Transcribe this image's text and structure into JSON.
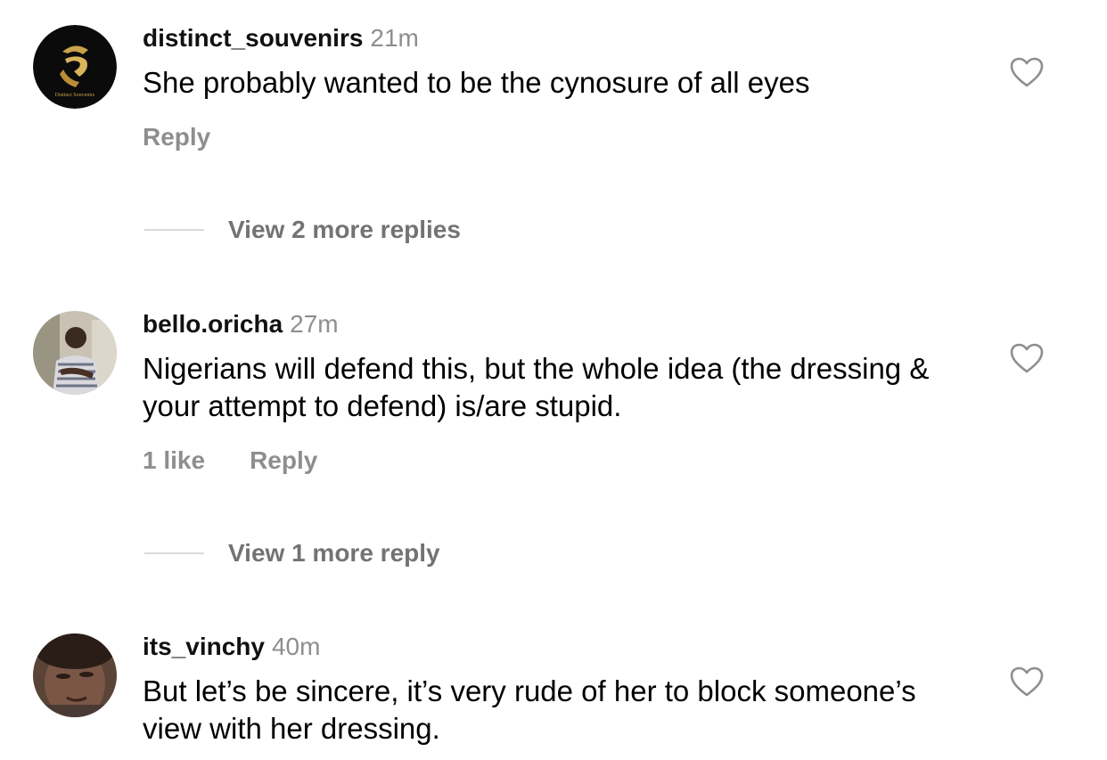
{
  "comments": [
    {
      "username": "distinct_souvenirs",
      "time": "21m",
      "text": "She probably wanted to be the cynosure of all eyes",
      "likes": "",
      "reply_label": "Reply",
      "avatar_icon": "distinct-souvenirs-logo",
      "avatar_text": "Distinct Souvenirs",
      "view_replies": "View 2 more replies"
    },
    {
      "username": "bello.oricha",
      "time": "27m",
      "text": "Nigerians will defend this, but the whole idea (the dressing & your attempt to defend) is/are stupid.",
      "likes": "1 like",
      "reply_label": "Reply",
      "avatar_icon": "user-photo",
      "view_replies": "View 1 more reply"
    },
    {
      "username": "its_vinchy",
      "time": "40m",
      "text": "But let’s be sincere, it’s very rude of her to block someone’s view with her dressing.",
      "likes": "",
      "reply_label": "Reply",
      "avatar_icon": "user-photo"
    }
  ],
  "colors": {
    "secondary_text": "#8e8e8e",
    "divider": "#dbdbdb",
    "logo_gold": "#c9a24a"
  }
}
